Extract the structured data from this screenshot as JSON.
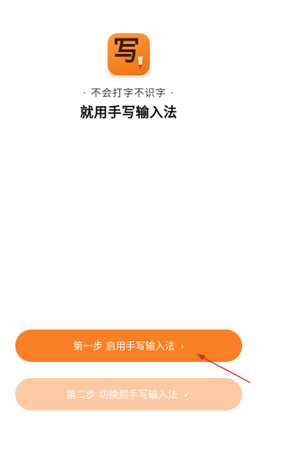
{
  "app_icon": {
    "glyph": "写",
    "icon": "pen-icon"
  },
  "tagline": "· 不会打字不识字 ·",
  "headline": "就用手写输入法",
  "buttons": {
    "step1": {
      "label": "第一步 启用手写输入法",
      "icon": "chevron-right-icon",
      "symbol": "›"
    },
    "step2": {
      "label": "第二步 切换到手写输入法",
      "icon": "check-icon",
      "symbol": "✓"
    }
  },
  "annotation": {
    "icon": "arrow-pointer-icon",
    "color": "#e0222a"
  },
  "colors": {
    "accent": "#f97f24",
    "accent_disabled": "#fdc9a2"
  }
}
